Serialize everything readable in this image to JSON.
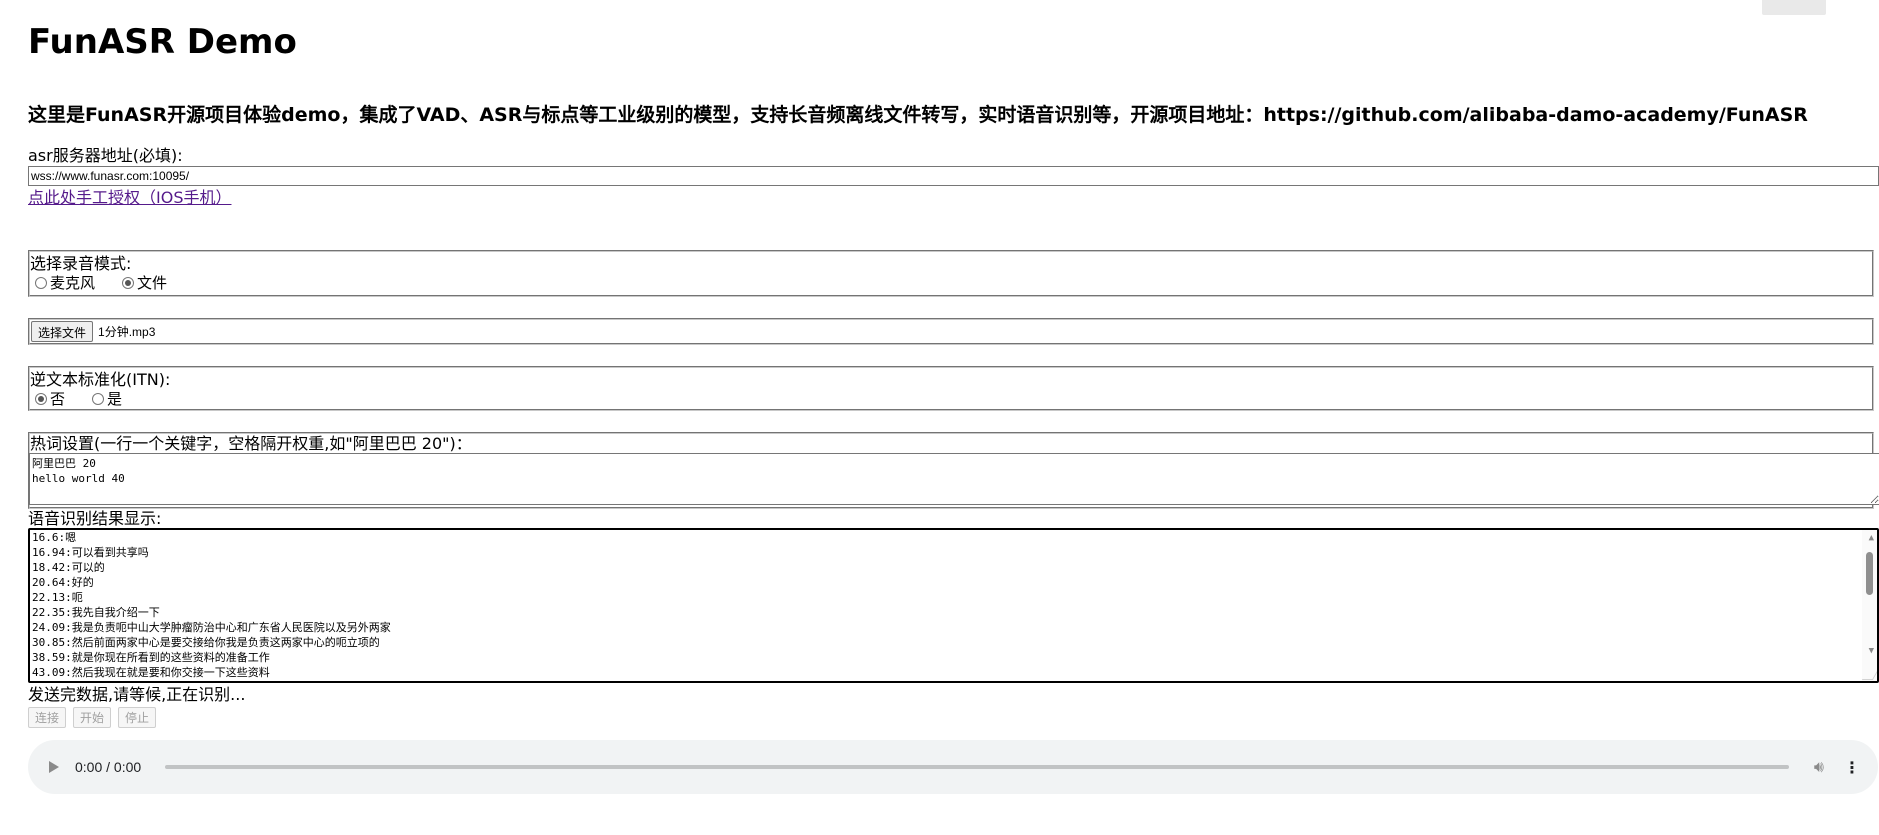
{
  "title": "FunASR Demo",
  "subtitle": "这里是FunASR开源项目体验demo，集成了VAD、ASR与标点等工业级别的模型，支持长音频离线文件转写，实时语音识别等，开源项目地址：https://github.com/alibaba-damo-academy/FunASR",
  "server": {
    "label": "asr服务器地址(必填):",
    "value": "wss://www.funasr.com:10095/"
  },
  "auth_link": "点此处手工授权（IOS手机）",
  "record_mode": {
    "label": "选择录音模式:",
    "options": [
      "麦克风",
      "文件"
    ],
    "selected": "文件"
  },
  "file": {
    "button": "选择文件",
    "name": "1分钟.mp3"
  },
  "itn": {
    "label": "逆文本标准化(ITN):",
    "options": [
      "否",
      "是"
    ],
    "selected": "否"
  },
  "hotwords": {
    "label": "热词设置(一行一个关键字，空格隔开权重,如\"阿里巴巴 20\")：",
    "value": "阿里巴巴 20\nhello world 40"
  },
  "result": {
    "label": "语音识别结果显示:",
    "lines": [
      "16.6:嗯",
      "16.94:可以看到共享吗",
      "18.42:可以的",
      "20.64:好的",
      "22.13:呃",
      "22.35:我先自我介绍一下",
      "24.09:我是负责呃中山大学肿瘤防治中心和广东省人民医院以及另外两家",
      "30.85:然后前面两家中心是要交接给你我是负责这两家中心的呃立项的",
      "38.59:就是你现在所看到的这些资料的准备工作",
      "43.09:然后我现在就是要和你交接一下这些资料"
    ]
  },
  "status": "发送完数据,请等候,正在识别...",
  "buttons": {
    "connect": "连接",
    "start": "开始",
    "stop": "停止"
  },
  "audio": {
    "time": "0:00 / 0:00"
  }
}
